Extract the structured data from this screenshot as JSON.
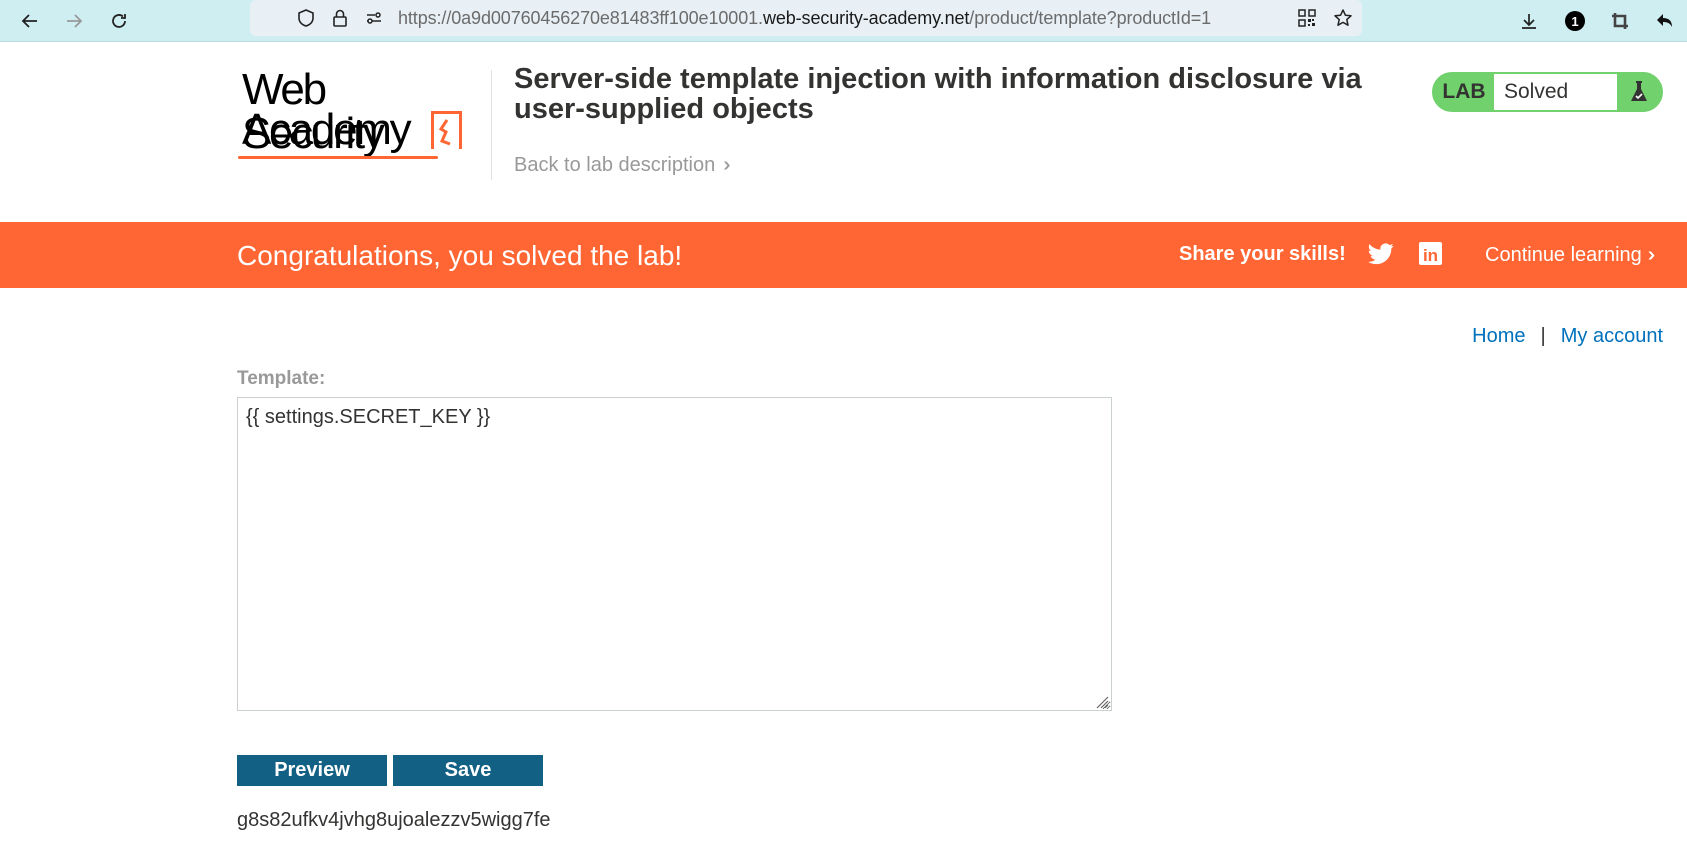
{
  "browser": {
    "url_prefix": "https://0a9d00760456270e81483ff100e10001.",
    "url_host": "web-security-academy.net",
    "url_path": "/product/template?productId=1",
    "extension_badge": "1",
    "icons": {
      "back": "arrow-left-icon",
      "forward": "arrow-right-icon",
      "reload": "reload-icon",
      "shield": "shield-icon",
      "lock": "lock-icon",
      "permissions": "sliders-icon",
      "qr": "qr-code-icon",
      "bookmark": "star-icon",
      "download": "download-icon",
      "crop": "crop-icon",
      "undo": "undo-icon"
    }
  },
  "header": {
    "logo_line1": "Web Security",
    "logo_line2": "Academy",
    "lab_title": "Server-side template injection with information disclosure via user-supplied objects",
    "back_link": "Back to lab description",
    "lab_badge": "LAB",
    "lab_status": "Solved"
  },
  "banner": {
    "message": "Congratulations, you solved the lab!",
    "share_label": "Share your skills!",
    "linkedin_label": "in",
    "continue_label": "Continue learning"
  },
  "nav": {
    "home": "Home",
    "separator": "|",
    "account": "My account"
  },
  "form": {
    "template_label": "Template:",
    "template_value": "{{ settings.SECRET_KEY }}",
    "preview_button": "Preview",
    "save_button": "Save"
  },
  "output": {
    "rendered_text": "g8s82ufkv4jvhg8ujoalezzv5wigg7fe"
  },
  "colors": {
    "brand_orange": "#ff6633",
    "solved_green": "#70d16d",
    "button_blue": "#126184",
    "link_blue": "#0071bc"
  }
}
